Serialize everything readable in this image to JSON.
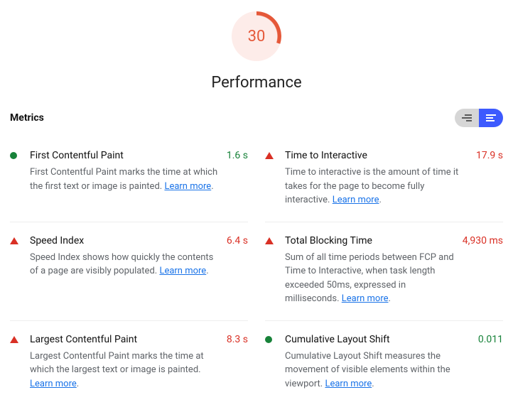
{
  "gauge": {
    "score": "30",
    "title": "Performance"
  },
  "section_label": "Metrics",
  "learn_more": "Learn more",
  "metrics": [
    {
      "status": "pass",
      "name": "First Contentful Paint",
      "desc": "First Contentful Paint marks the time at which the first text or image is painted.",
      "value": "1.6 s"
    },
    {
      "status": "fail",
      "name": "Time to Interactive",
      "desc": "Time to interactive is the amount of time it takes for the page to become fully interactive.",
      "value": "17.9 s"
    },
    {
      "status": "fail",
      "name": "Speed Index",
      "desc": "Speed Index shows how quickly the contents of a page are visibly populated.",
      "value": "6.4 s"
    },
    {
      "status": "fail",
      "name": "Total Blocking Time",
      "desc": "Sum of all time periods between FCP and Time to Interactive, when task length exceeded 50ms, expressed in milliseconds.",
      "value": "4,930 ms"
    },
    {
      "status": "fail",
      "name": "Largest Contentful Paint",
      "desc": "Largest Contentful Paint marks the time at which the largest text or image is painted.",
      "value": "8.3 s"
    },
    {
      "status": "pass",
      "name": "Cumulative Layout Shift",
      "desc": "Cumulative Layout Shift measures the movement of visible elements within the viewport.",
      "value": "0.011"
    }
  ]
}
